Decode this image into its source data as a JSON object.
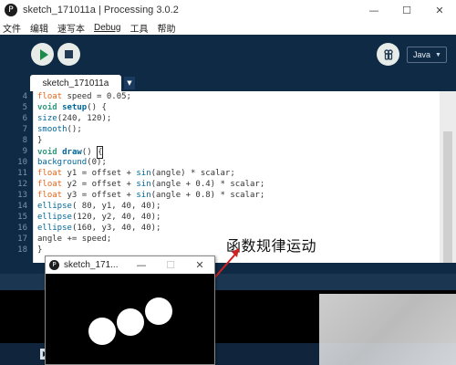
{
  "window": {
    "title": "sketch_171011a | Processing 3.0.2",
    "minimize": "—",
    "maximize": "☐",
    "close": "✕"
  },
  "menu": [
    "文件",
    "编辑",
    "速写本",
    "Debug",
    "工具",
    "帮助"
  ],
  "toolbar": {
    "mode": "Java"
  },
  "tab": {
    "name": "sketch_171011a"
  },
  "code_lines": [
    {
      "num": "4",
      "text": "float speed = 0.05;"
    },
    {
      "num": "5",
      "text": "void setup() {"
    },
    {
      "num": "6",
      "text": "size(240, 120);"
    },
    {
      "num": "7",
      "text": "smooth();"
    },
    {
      "num": "8",
      "text": "}"
    },
    {
      "num": "9",
      "text": "void draw() {"
    },
    {
      "num": "10",
      "text": "background(0);"
    },
    {
      "num": "11",
      "text": "float y1 = offset + sin(angle) * scalar;"
    },
    {
      "num": "12",
      "text": "float y2 = offset + sin(angle + 0.4) * scalar;"
    },
    {
      "num": "13",
      "text": "float y3 = offset + sin(angle + 0.8) * scalar;"
    },
    {
      "num": "14",
      "text": "ellipse( 80, y1, 40, 40);"
    },
    {
      "num": "15",
      "text": "ellipse(120, y2, 40, 40);"
    },
    {
      "num": "16",
      "text": "ellipse(160, y3, 40, 40);"
    },
    {
      "num": "17",
      "text": "angle += speed;"
    },
    {
      "num": "18",
      "text": "}"
    }
  ],
  "annotation": "函数规律运动",
  "sketch_window": {
    "title": "sketch_171...",
    "minimize": "—",
    "maximize": "☐",
    "close": "✕"
  },
  "colors": {
    "editor_bg": "#ffffff",
    "chrome_bg": "#0e2a44",
    "keyword": "#33997e",
    "type": "#e2661a",
    "function": "#006699"
  }
}
